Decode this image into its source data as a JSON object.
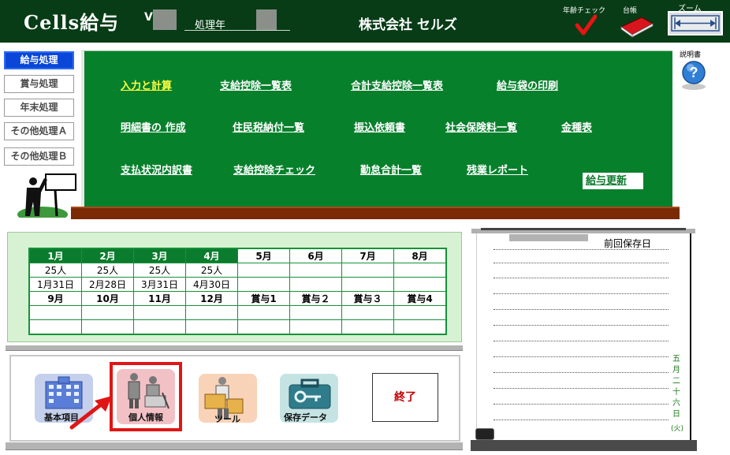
{
  "header": {
    "app_title": "Cells給与",
    "version_prefix": "V",
    "year_label": "処理年",
    "company": "株式会社 セルズ",
    "age_check_label": "年齢チェック",
    "ledger_label": "台帳",
    "zoom_label": "ズーム"
  },
  "side_menu": [
    {
      "label": "給与処理",
      "active": true
    },
    {
      "label": "賞与処理",
      "active": false
    },
    {
      "label": "年末処理",
      "active": false
    },
    {
      "label": "その他処理Ａ",
      "active": false
    },
    {
      "label": "その他処理Ｂ",
      "active": false
    }
  ],
  "board": {
    "links": [
      {
        "label": "入力と計算",
        "highlight": true
      },
      {
        "label": "支給控除一覧表"
      },
      {
        "label": "合計支給控除一覧表"
      },
      {
        "label": "給与袋の印刷"
      },
      {
        "label": "明細書の 作成"
      },
      {
        "label": "住民税納付一覧"
      },
      {
        "label": "振込依頼書"
      },
      {
        "label": "社会保険料一覧"
      },
      {
        "label": "金種表"
      },
      {
        "label": "支払状況内訳書"
      },
      {
        "label": "支給控除チェック"
      },
      {
        "label": "勤怠合計一覧"
      },
      {
        "label": "残業レポート"
      }
    ],
    "update_button": "給与更新"
  },
  "manual_label": "説明書",
  "calendar": {
    "months_row1": [
      "1月",
      "2月",
      "3月",
      "4月",
      "5月",
      "6月",
      "7月",
      "8月"
    ],
    "counts_row1": [
      "25人",
      "25人",
      "25人",
      "25人",
      "",
      "",
      "",
      ""
    ],
    "dates_row1": [
      "1月31日",
      "2月28日",
      "3月31日",
      "4月30日",
      "",
      "",
      "",
      ""
    ],
    "months_row2": [
      "9月",
      "10月",
      "11月",
      "12月",
      "賞与1",
      "賞与２",
      "賞与３",
      "賞与4"
    ],
    "active_months": 4
  },
  "tiles": {
    "basic": "基本項目",
    "personal": "個人情報",
    "tools": "ツール",
    "backup": "保存データ",
    "exit": "終了"
  },
  "scroll": {
    "last_save_label": "前回保存日",
    "vertical_date": [
      "五",
      "月",
      "二",
      "十",
      "六",
      "日"
    ],
    "weekday": "(火)"
  },
  "colors": {
    "header_bg": "#073c16",
    "board_green": "#07802c",
    "active_blue": "#0a47d8",
    "highlight_yellow": "#ffff40",
    "selection_red": "#e01616"
  }
}
